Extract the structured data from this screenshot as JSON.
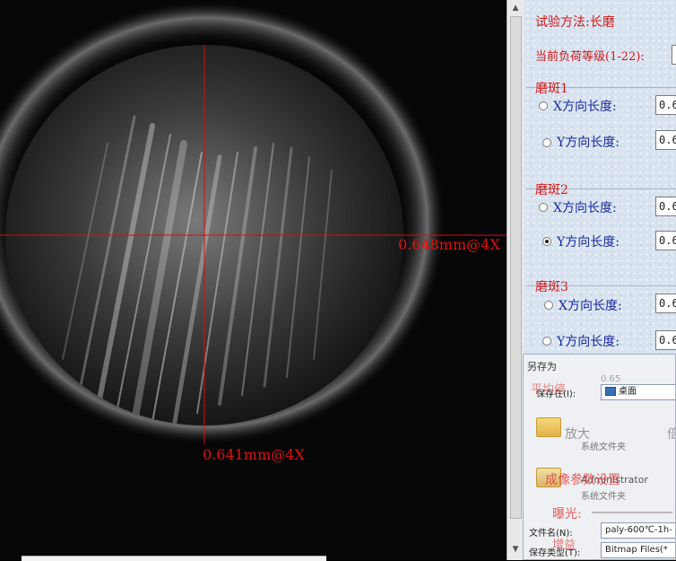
{
  "viewport": {
    "measure_horizontal": "0.648mm@4X",
    "measure_vertical": "0.641mm@4X"
  },
  "panel": {
    "method": "试验方法:长磨",
    "load_level": "当前负荷等级(1-22):",
    "scar1": {
      "title": "磨斑1",
      "x_label": "X方向长度:",
      "y_label": "Y方向长度:",
      "x_value": "0.6",
      "y_value": "0.6",
      "selected": "x"
    },
    "scar2": {
      "title": "磨斑2",
      "x_label": "X方向长度:",
      "y_label": "Y方向长度:",
      "x_value": "0.6",
      "y_value": "0.6",
      "selected": "y"
    },
    "scar3": {
      "title": "磨斑3",
      "x_label": "X方向长度:",
      "y_label": "Y方向长度:",
      "x_value": "0.6",
      "y_value": "0.6",
      "selected": "none"
    }
  },
  "dialog": {
    "title": "另存为",
    "save_in_label": "保存在(I):",
    "save_in_value": "桌面",
    "ghost_avg": "平均值",
    "ghost_avg_value": "0.65",
    "ghost_zoom": "放大",
    "ghost_zoom2": "倍",
    "folder1_sub": "系统文件夹",
    "admin": "Administrator",
    "folder2_sub": "系统文件夹",
    "ghost_imaging": "成像参数设置",
    "ghost_exposure": "曝光:",
    "ghost_gain": "增益",
    "filename_label": "文件名(N):",
    "filename_value": "paly-600℃-1h-",
    "filetype_label": "保存类型(T):",
    "filetype_value": "Bitmap Files(*"
  }
}
